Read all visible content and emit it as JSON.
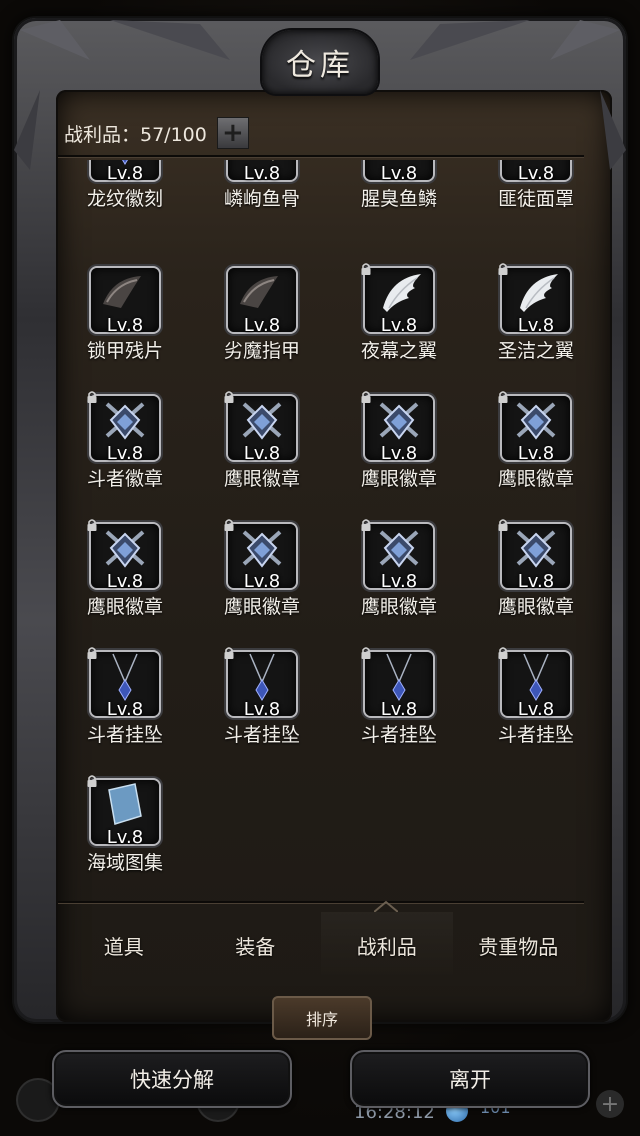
{
  "window": {
    "title": "仓库"
  },
  "capacity": {
    "label": "战利品：57/100",
    "add_button": "+"
  },
  "items": [
    {
      "name": "龙纹徽刻",
      "level": "Lv.8",
      "icon": "pendant-icon",
      "locked": false
    },
    {
      "name": "嶙峋鱼骨",
      "level": "Lv.8",
      "icon": "fishbone-icon",
      "locked": false
    },
    {
      "name": "腥臭鱼鳞",
      "level": "Lv.8",
      "icon": "fish-scale-icon",
      "locked": false
    },
    {
      "name": "匪徒面罩",
      "level": "Lv.8",
      "icon": "mask-icon",
      "locked": false
    },
    {
      "name": "锁甲残片",
      "level": "Lv.8",
      "icon": "chain-fragment-icon",
      "locked": false
    },
    {
      "name": "劣魔指甲",
      "level": "Lv.8",
      "icon": "claw-icon",
      "locked": false
    },
    {
      "name": "夜幕之翼",
      "level": "Lv.8",
      "icon": "wing-icon",
      "locked": true
    },
    {
      "name": "圣洁之翼",
      "level": "Lv.8",
      "icon": "wing-icon",
      "locked": true
    },
    {
      "name": "斗者徽章",
      "level": "Lv.8",
      "icon": "badge-icon",
      "locked": true
    },
    {
      "name": "鹰眼徽章",
      "level": "Lv.8",
      "icon": "badge-icon",
      "locked": true
    },
    {
      "name": "鹰眼徽章",
      "level": "Lv.8",
      "icon": "badge-icon",
      "locked": true
    },
    {
      "name": "鹰眼徽章",
      "level": "Lv.8",
      "icon": "badge-icon",
      "locked": true
    },
    {
      "name": "鹰眼徽章",
      "level": "Lv.8",
      "icon": "badge-icon",
      "locked": true
    },
    {
      "name": "鹰眼徽章",
      "level": "Lv.8",
      "icon": "badge-icon",
      "locked": true
    },
    {
      "name": "鹰眼徽章",
      "level": "Lv.8",
      "icon": "badge-icon",
      "locked": true
    },
    {
      "name": "鹰眼徽章",
      "level": "Lv.8",
      "icon": "badge-icon",
      "locked": true
    },
    {
      "name": "斗者挂坠",
      "level": "Lv.8",
      "icon": "pendant-icon",
      "locked": true
    },
    {
      "name": "斗者挂坠",
      "level": "Lv.8",
      "icon": "pendant-icon",
      "locked": true
    },
    {
      "name": "斗者挂坠",
      "level": "Lv.8",
      "icon": "pendant-icon",
      "locked": true
    },
    {
      "name": "斗者挂坠",
      "level": "Lv.8",
      "icon": "pendant-icon",
      "locked": true
    },
    {
      "name": "海域图集",
      "level": "Lv.8",
      "icon": "book-icon",
      "locked": true
    }
  ],
  "tabs": [
    {
      "label": "道具",
      "active": false
    },
    {
      "label": "装备",
      "active": false
    },
    {
      "label": "战利品",
      "active": true
    },
    {
      "label": "贵重物品",
      "active": false
    }
  ],
  "buttons": {
    "sort": "排序",
    "quick_decompose": "快速分解",
    "leave": "离开"
  },
  "background_hud": {
    "clock": "16:28:12",
    "count": "101"
  }
}
